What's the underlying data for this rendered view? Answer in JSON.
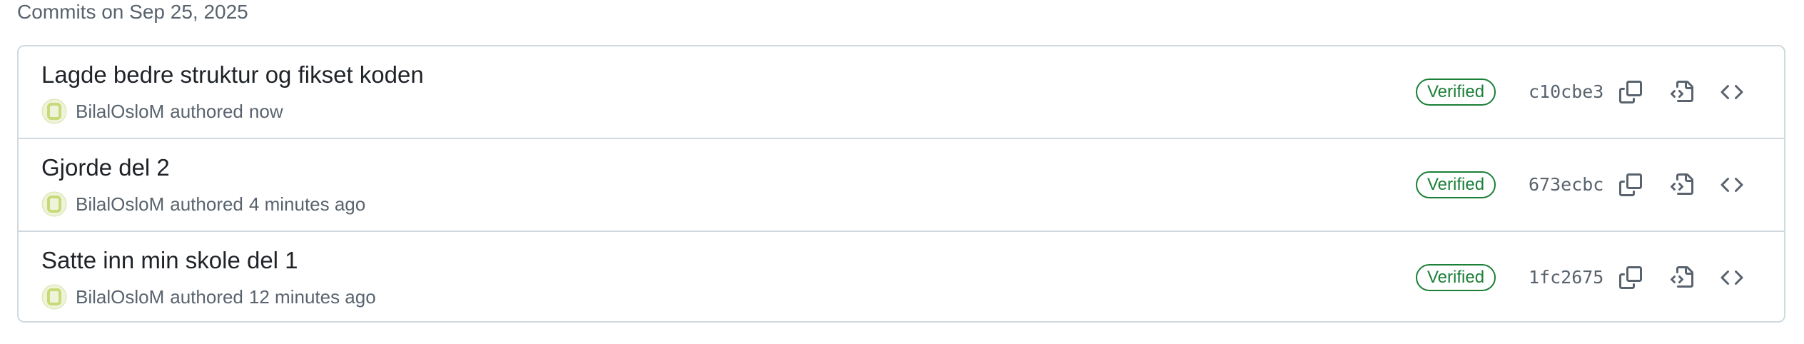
{
  "header": {
    "date_label": "Commits on Sep 25, 2025"
  },
  "colors": {
    "verified": "#1a7f37",
    "border": "#d1d9e0",
    "muted": "#59636e"
  },
  "commits": [
    {
      "title": "Lagde bedre struktur og fikset koden",
      "author": "BilalOsloM",
      "authored_label": "authored",
      "time": "now",
      "badge": "Verified",
      "sha": "c10cbe3"
    },
    {
      "title": "Gjorde del 2",
      "author": "BilalOsloM",
      "authored_label": "authored",
      "time": "4 minutes ago",
      "badge": "Verified",
      "sha": "673ecbc"
    },
    {
      "title": "Satte inn min skole del 1",
      "author": "BilalOsloM",
      "authored_label": "authored",
      "time": "12 minutes ago",
      "badge": "Verified",
      "sha": "1fc2675"
    }
  ],
  "icons": {
    "copy": "copy-icon",
    "browse": "file-code-icon",
    "code": "code-icon",
    "avatar": "avatar"
  }
}
